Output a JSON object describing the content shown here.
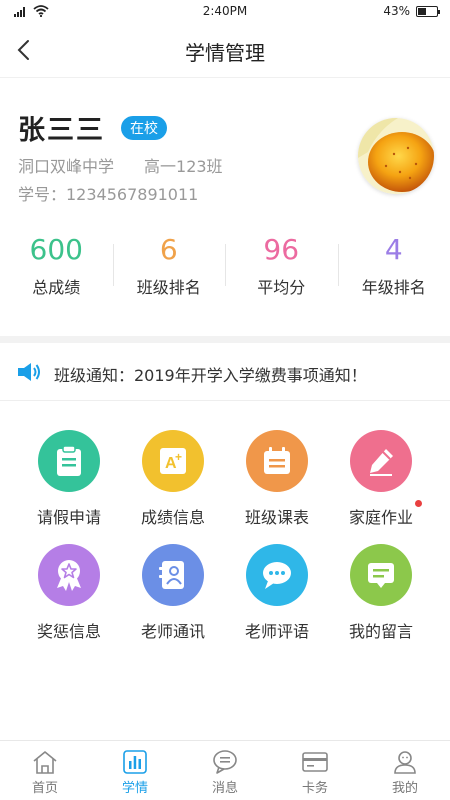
{
  "status_bar": {
    "time": "2:40PM",
    "battery": "43%",
    "battery_level": 0.43
  },
  "nav": {
    "title": "学情管理"
  },
  "profile": {
    "name": "张三三",
    "status": "在校",
    "school": "洞口双峰中学",
    "class": "高一123班",
    "student_id": "学号：1234567891011"
  },
  "stats": [
    {
      "value": "600",
      "label": "总成绩",
      "color": "#3cc28b"
    },
    {
      "value": "6",
      "label": "班级排名",
      "color": "#f0a24a"
    },
    {
      "value": "96",
      "label": "平均分",
      "color": "#ec6aa0"
    },
    {
      "value": "4",
      "label": "年级排名",
      "color": "#9b7de6"
    }
  ],
  "notice": {
    "text": "班级通知：2019年开学入学缴费事项通知！",
    "icon": "speaker-icon"
  },
  "grid": [
    {
      "label": "请假申请",
      "icon": "clipboard-icon",
      "color": "#34c39a"
    },
    {
      "label": "成绩信息",
      "icon": "grade-icon",
      "color": "#f2c12e"
    },
    {
      "label": "班级课表",
      "icon": "calendar-icon",
      "color": "#f0974a"
    },
    {
      "label": "家庭作业",
      "icon": "pencil-icon",
      "color": "#ef6f8e"
    },
    {
      "label": "奖惩信息",
      "icon": "award-icon",
      "color": "#b57ee6"
    },
    {
      "label": "老师通讯",
      "icon": "contacts-icon",
      "color": "#6b8fe6"
    },
    {
      "label": "老师评语",
      "icon": "chat-icon",
      "color": "#2fb7e8"
    },
    {
      "label": "我的留言",
      "icon": "message-icon",
      "color": "#8cc84b"
    }
  ],
  "tabs": [
    {
      "label": "首页",
      "icon": "home-icon"
    },
    {
      "label": "学情",
      "icon": "chart-icon",
      "active": true
    },
    {
      "label": "消息",
      "icon": "message-bubble-icon"
    },
    {
      "label": "卡务",
      "icon": "card-icon"
    },
    {
      "label": "我的",
      "icon": "user-icon"
    }
  ],
  "accent": "#1a9fe8"
}
